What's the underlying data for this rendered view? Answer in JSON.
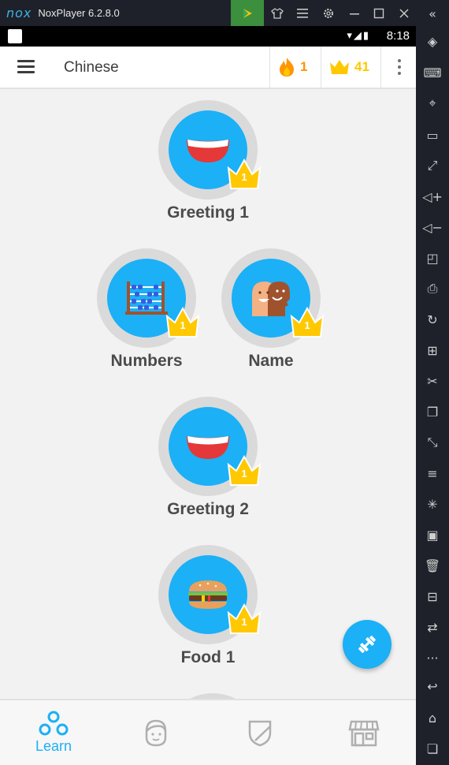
{
  "window": {
    "logo": "nox",
    "title": "NoxPlayer 6.2.8.0"
  },
  "statusbar": {
    "time": "8:18"
  },
  "appbar": {
    "course_title": "Chinese",
    "streak": "1",
    "crowns": "41"
  },
  "skills": [
    {
      "name": "Greeting 1",
      "level": "1",
      "icon": "smile-icon"
    },
    {
      "name": "Numbers",
      "level": "1",
      "icon": "abacus-icon"
    },
    {
      "name": "Name",
      "level": "1",
      "icon": "faces-icon"
    },
    {
      "name": "Greeting 2",
      "level": "1",
      "icon": "smile-icon"
    },
    {
      "name": "Food 1",
      "level": "1",
      "icon": "burger-icon"
    }
  ],
  "bottom_nav": [
    {
      "label": "Learn",
      "icon": "learn-icon",
      "active": true
    },
    {
      "label": "",
      "icon": "profile-icon",
      "active": false
    },
    {
      "label": "",
      "icon": "shield-icon",
      "active": false
    },
    {
      "label": "",
      "icon": "shop-icon",
      "active": false
    }
  ],
  "colors": {
    "accent": "#1cb0f6",
    "streak": "#ff9600",
    "crown": "#ffc800",
    "text": "#4b4b4b"
  }
}
